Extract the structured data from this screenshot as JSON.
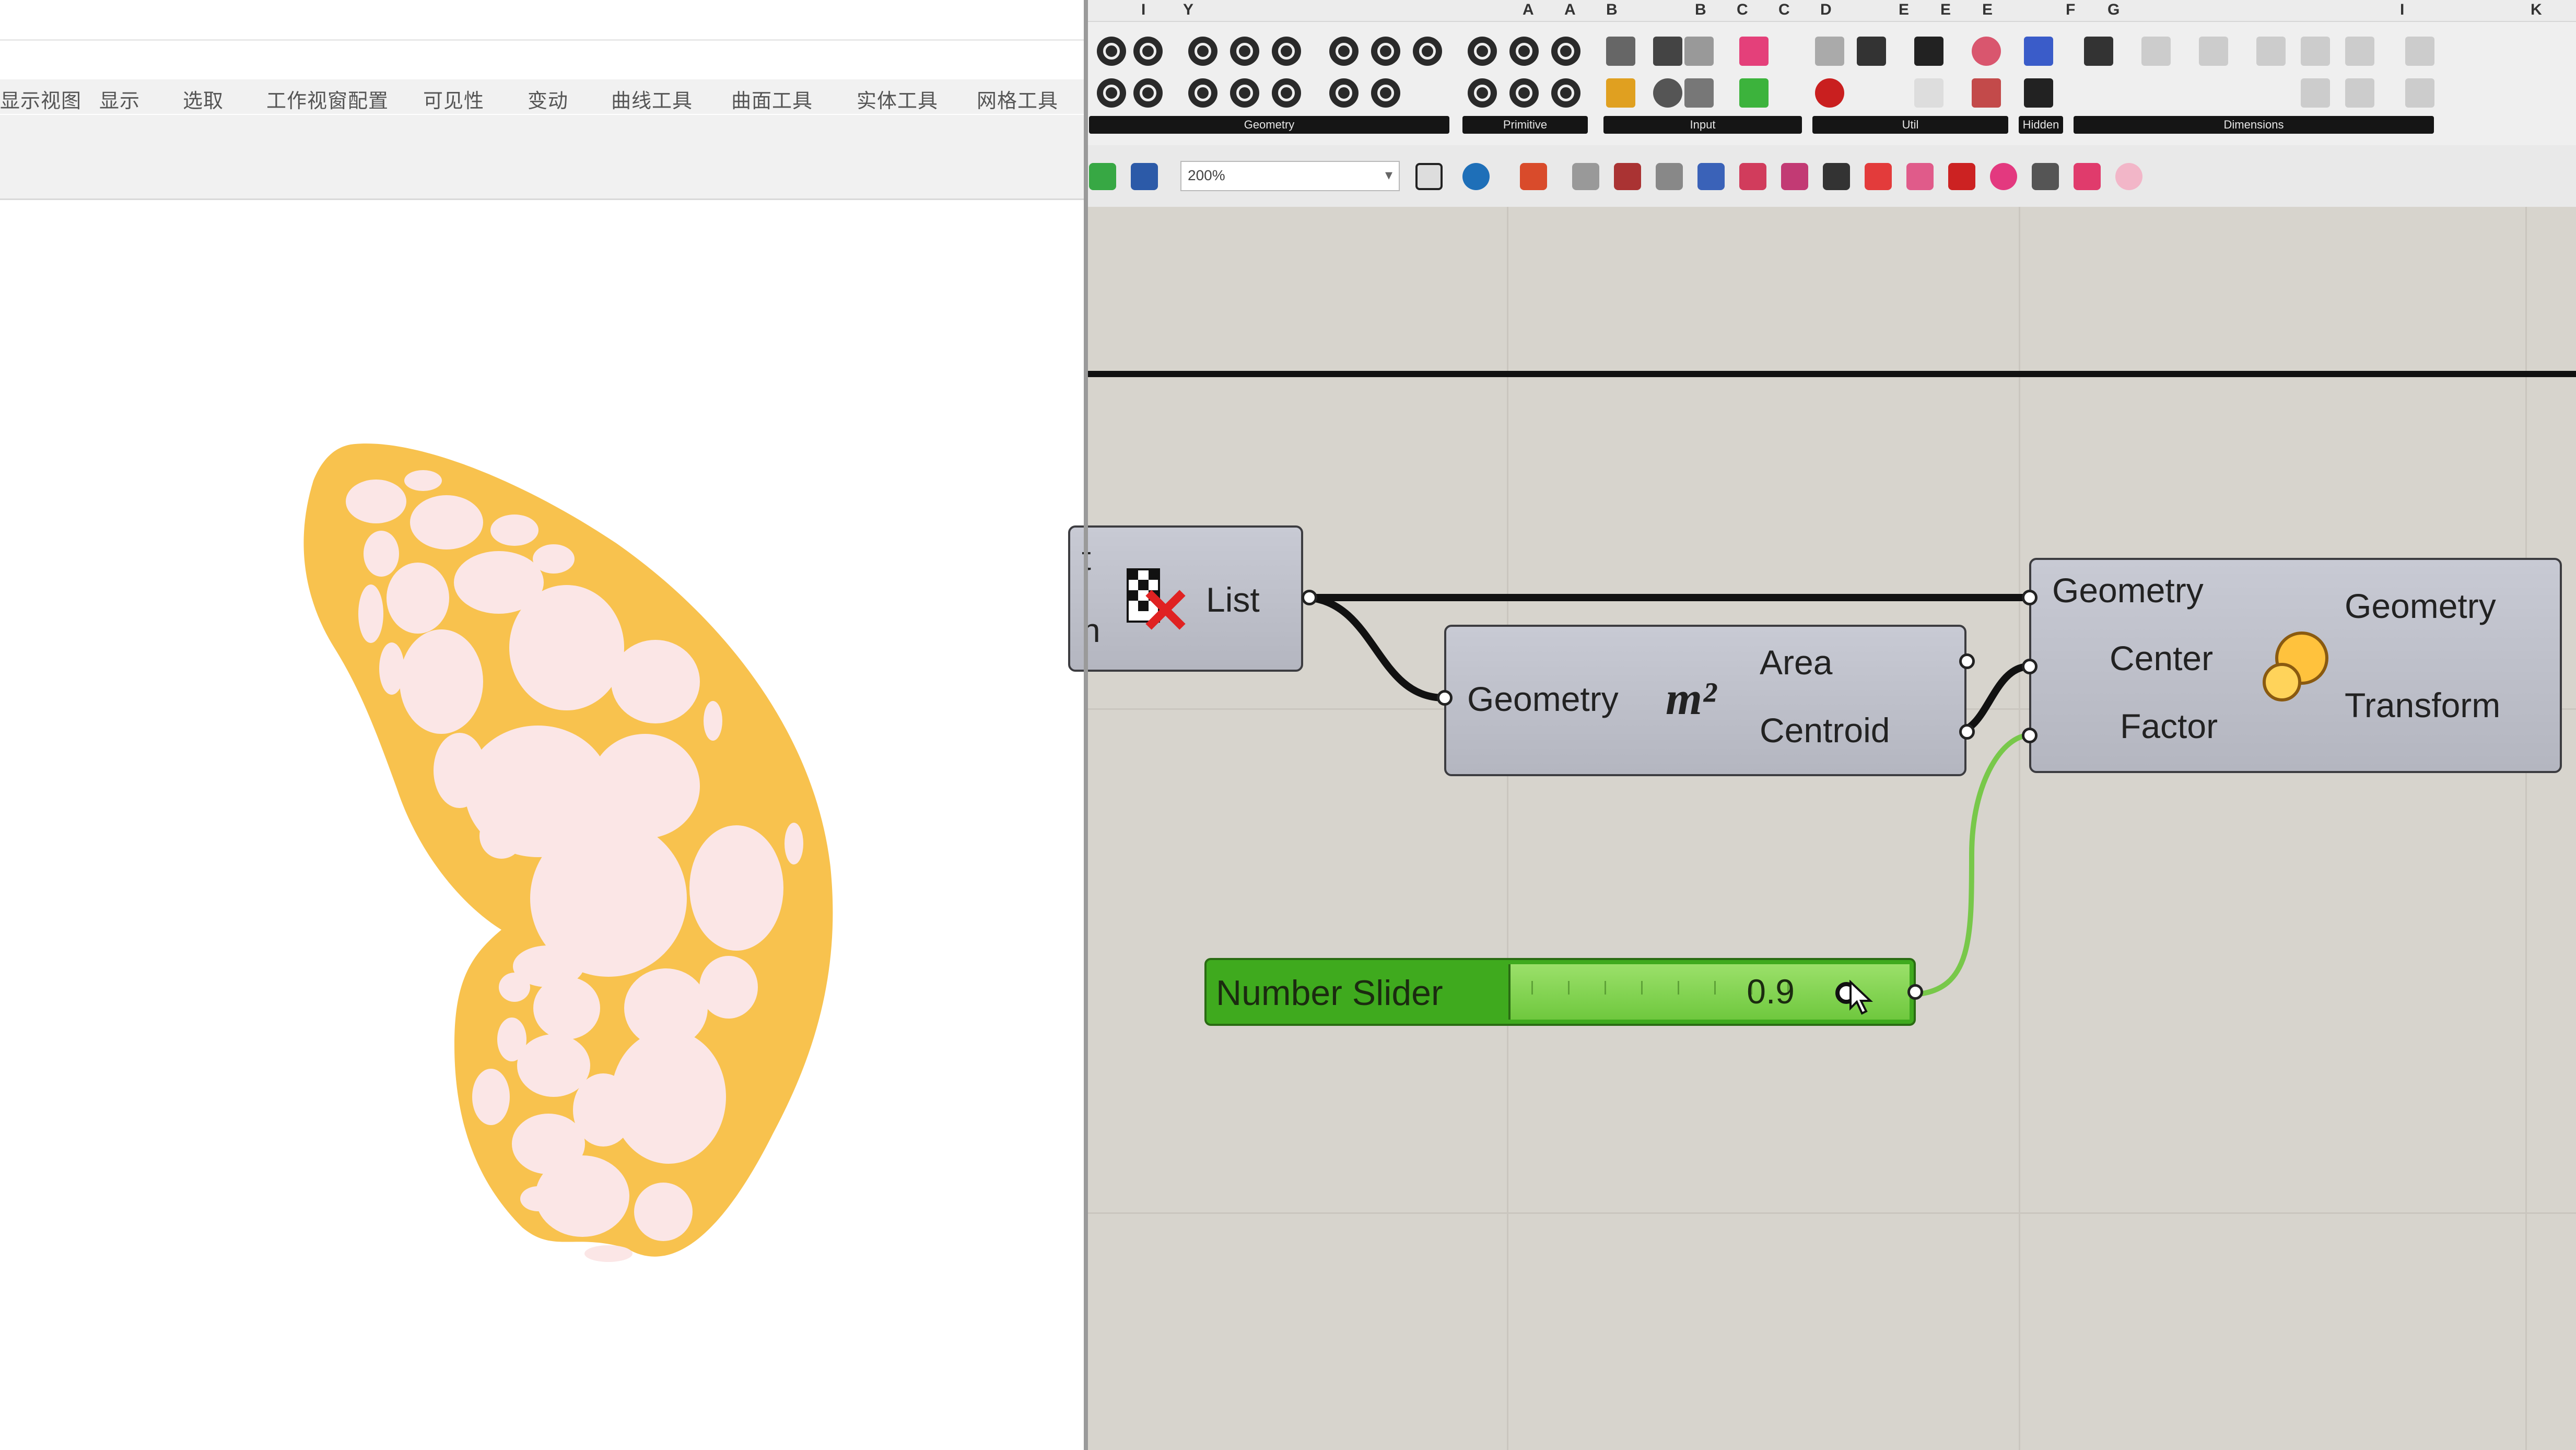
{
  "rhino": {
    "menu_tabs": [
      "显示视图",
      "显示",
      "选取",
      "工作视窗配置",
      "可见性",
      "变动",
      "曲线工具",
      "曲面工具",
      "实体工具",
      "网格工具"
    ]
  },
  "grasshopper": {
    "category_letters": [
      "I",
      "Y",
      "A",
      "A",
      "B",
      "B",
      "C",
      "C",
      "D",
      "E",
      "E",
      "E",
      "F",
      "G",
      "I",
      "K"
    ],
    "panels": [
      "Geometry",
      "Primitive",
      "Input",
      "Util",
      "Hidden",
      "Dimensions"
    ],
    "zoom": "200%",
    "nodes": {
      "cull": {
        "output_label": "List",
        "input_letter_1": "t",
        "input_letter_2": "n"
      },
      "area": {
        "input": "Geometry",
        "icon": "m²",
        "outputs": [
          "Area",
          "Centroid"
        ]
      },
      "scale": {
        "inputs": [
          "Geometry",
          "Center",
          "Factor"
        ],
        "outputs": [
          "Geometry",
          "Transform"
        ]
      }
    },
    "slider": {
      "label": "Number Slider",
      "value": "0.9"
    }
  },
  "colors": {
    "wing": "#f8c24e",
    "spots": "#fbe6e6",
    "canvas": "#d7d4cd",
    "slider": "#3faa1e"
  }
}
